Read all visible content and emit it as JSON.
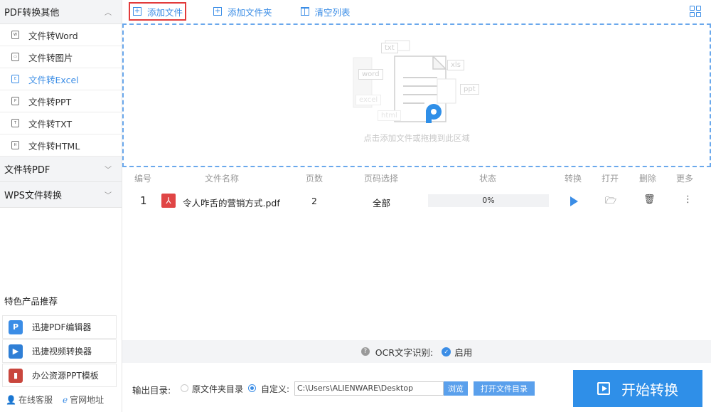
{
  "sidebar": {
    "group1": {
      "label": "PDF转换其他",
      "chevron": "chevron-up-icon"
    },
    "items": [
      {
        "label": "文件转Word",
        "icon": "W"
      },
      {
        "label": "文件转图片",
        "icon": "▭"
      },
      {
        "label": "文件转Excel",
        "icon": "E"
      },
      {
        "label": "文件转PPT",
        "icon": "P"
      },
      {
        "label": "文件转TXT",
        "icon": "T"
      },
      {
        "label": "文件转HTML",
        "icon": "H"
      }
    ],
    "group2": {
      "label": "文件转PDF"
    },
    "group3": {
      "label": "WPS文件转换"
    },
    "promo_title": "特色产品推荐",
    "promos": [
      {
        "label": "迅捷PDF编辑器"
      },
      {
        "label": "迅捷视频转换器"
      },
      {
        "label": "办公资源PPT模板"
      }
    ],
    "footer": {
      "service": "在线客服",
      "website": "官网地址"
    }
  },
  "toolbar": {
    "add_file": "添加文件",
    "add_folder": "添加文件夹",
    "clear_list": "清空列表"
  },
  "dropzone": {
    "hint": "点击添加文件或拖拽到此区域",
    "tags": [
      "txt",
      "xls",
      "word",
      "ppt",
      "excel",
      "html"
    ]
  },
  "table": {
    "headers": {
      "num": "编号",
      "name": "文件名称",
      "pages": "页数",
      "range": "页码选择",
      "status": "状态",
      "convert": "转换",
      "open": "打开",
      "delete": "删除",
      "more": "更多"
    },
    "rows": [
      {
        "num": "1",
        "name": "令人咋舌的营销方式.pdf",
        "pages": "2",
        "range": "全部",
        "progress_text": "0%",
        "more": "⋮"
      }
    ]
  },
  "ocr": {
    "label": "OCR文字识别:",
    "value": "启用"
  },
  "output": {
    "label": "输出目录:",
    "option_source": "原文件夹目录",
    "option_custom": "自定义:",
    "path": "C:\\Users\\ALIENWARE\\Desktop",
    "browse": "浏览",
    "open_dir": "打开文件目录",
    "start": "开始转换"
  },
  "colors": {
    "accent": "#3b8de6",
    "highlight_box": "#e23b3b",
    "start_button": "#2f8fe8"
  }
}
